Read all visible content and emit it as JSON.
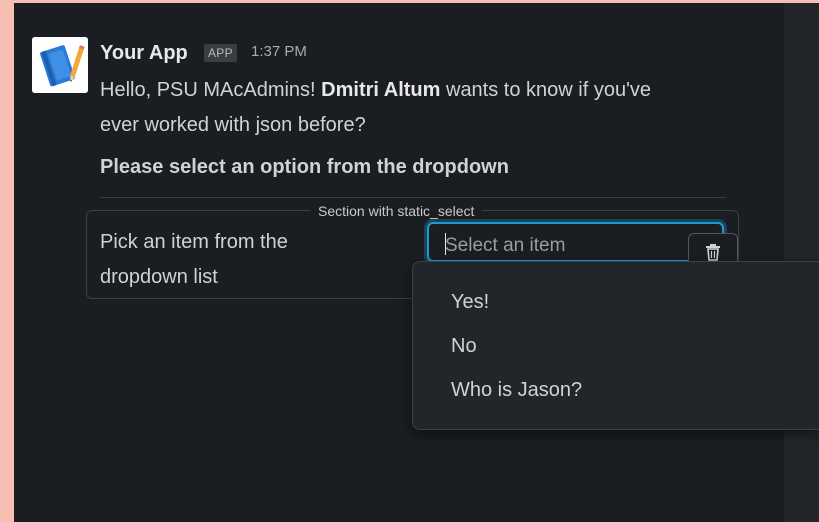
{
  "message": {
    "app_name": "Your App",
    "badge": "APP",
    "time": "1:37 PM",
    "text_prefix": "Hello, PSU MAcAdmins! ",
    "text_bold": "Dmitri Altum",
    "text_suffix": " wants to know if you've ever worked with json before?",
    "heading": "Please select an option from the dropdown"
  },
  "section": {
    "label": "Section with static_select",
    "text_line1": "Pick an item from the",
    "text_line2": "dropdown list",
    "select_placeholder": "Select an item"
  },
  "dropdown": {
    "options": [
      "Yes!",
      "No",
      "Who is Jason?"
    ]
  },
  "icons": {
    "avatar": "notebook-pencil-icon",
    "clear": "trash-icon"
  },
  "colors": {
    "background": "#1a1d21",
    "accent": "#1d9bd1",
    "frame": "#f7bfb2"
  }
}
